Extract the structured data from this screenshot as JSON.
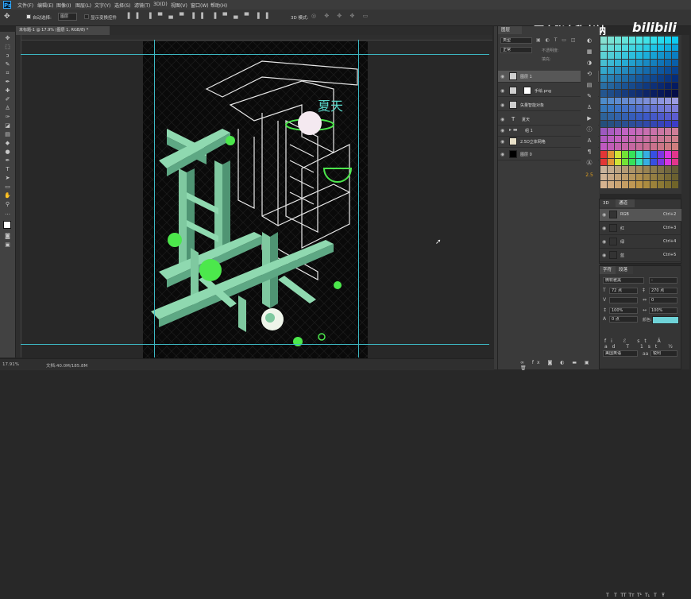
{
  "menu": [
    "文件(F)",
    "编辑(E)",
    "图像(I)",
    "图层(L)",
    "文字(Y)",
    "选择(S)",
    "滤镜(T)",
    "3D(D)",
    "视图(V)",
    "窗口(W)",
    "帮助(H)"
  ],
  "options": {
    "auto_select": "自动选择:",
    "auto_select_value": "图层",
    "show_transform": "显示变换控件",
    "mode_3d": "3D 模式:"
  },
  "document_tab": "未标题-1 @ 17.9% (图层 1, RGB/8) *",
  "status": {
    "zoom": "17.91%",
    "doc": "文档:40.0M/185.8M"
  },
  "watermark": "野人张自称老衲",
  "bilibili": "bilibili",
  "layers_panel": {
    "tab": "图层",
    "filter": "类型",
    "blend": "正常",
    "opacity": "不透明度:",
    "fill": "填充:",
    "layers": [
      "图层 1",
      "手绘.png",
      "矢量智能对象",
      "夏天",
      "组 1",
      "2.5D立体网格",
      "图层 0"
    ]
  },
  "artwork": {
    "summer_text": "夏天"
  },
  "channels": {
    "tabs": [
      "3D",
      "通道"
    ],
    "rows": [
      {
        "name": "RGB",
        "shortcut": "Ctrl+2"
      },
      {
        "name": "红",
        "shortcut": "Ctrl+3"
      },
      {
        "name": "绿",
        "shortcut": "Ctrl+4"
      },
      {
        "name": "蓝",
        "shortcut": "Ctrl+5"
      }
    ]
  },
  "character": {
    "tabs": [
      "字符",
      "段落"
    ],
    "font": "微软雅黑",
    "size": "72 点",
    "leading": "270 点",
    "tracking": "100%",
    "scale": "100%",
    "baseline": "0 点",
    "color_label": "颜色:",
    "color": "#6fd3d8",
    "language": "美国英语",
    "aa": "锐利"
  },
  "colors": {
    "accent_green": "#4ce84c",
    "mint": "#7fc9a0",
    "guide": "#3db9c4"
  }
}
